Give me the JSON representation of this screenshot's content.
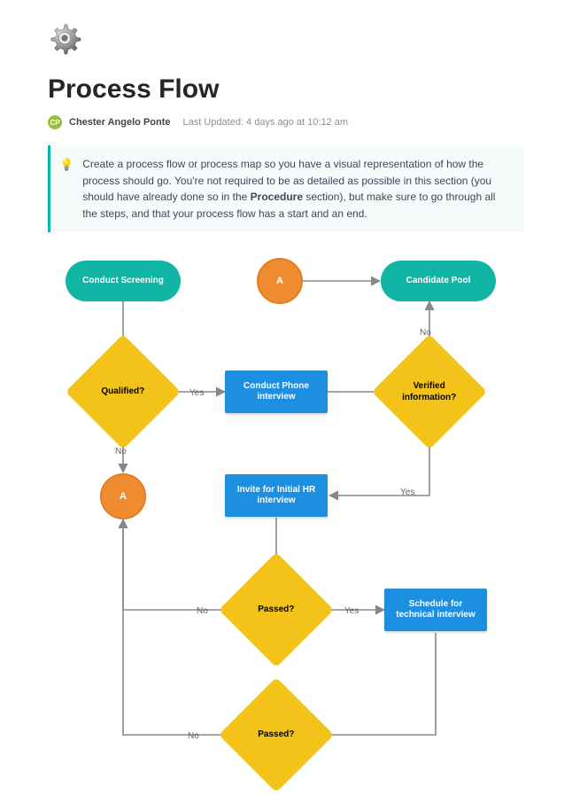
{
  "page": {
    "title": "Process Flow",
    "author_initials": "CP",
    "author_name": "Chester Angelo Ponte",
    "updated": "Last Updated: 4 days ago at 10:12 am"
  },
  "tip": {
    "text_before": "Create a process flow or process map so you have a visual representation of how the process should go. You're not required to be as detailed as possible in this section (you should have already done so in the ",
    "strong": "Procedure",
    "text_after": " section), but make sure to go through all the steps, and that your process flow has a start and an end."
  },
  "flow": {
    "nodes": {
      "conduct_screening": "Conduct Screening",
      "connector_a_top": "A",
      "candidate_pool": "Candidate Pool",
      "qualified": "Qualified?",
      "conduct_phone": "Conduct Phone interview",
      "verified_info": "Verified information?",
      "connector_a_left": "A",
      "invite_hr": "Invite for Initial HR interview",
      "passed1": "Passed?",
      "schedule_tech": "Schedule for technical interview",
      "passed2": "Passed?"
    },
    "edges": {
      "qualified_yes": "Yes",
      "qualified_no": "No",
      "verified_no": "No",
      "verified_yes": "Yes",
      "passed1_yes": "Yes",
      "passed1_no": "No",
      "passed2_no": "No"
    }
  }
}
